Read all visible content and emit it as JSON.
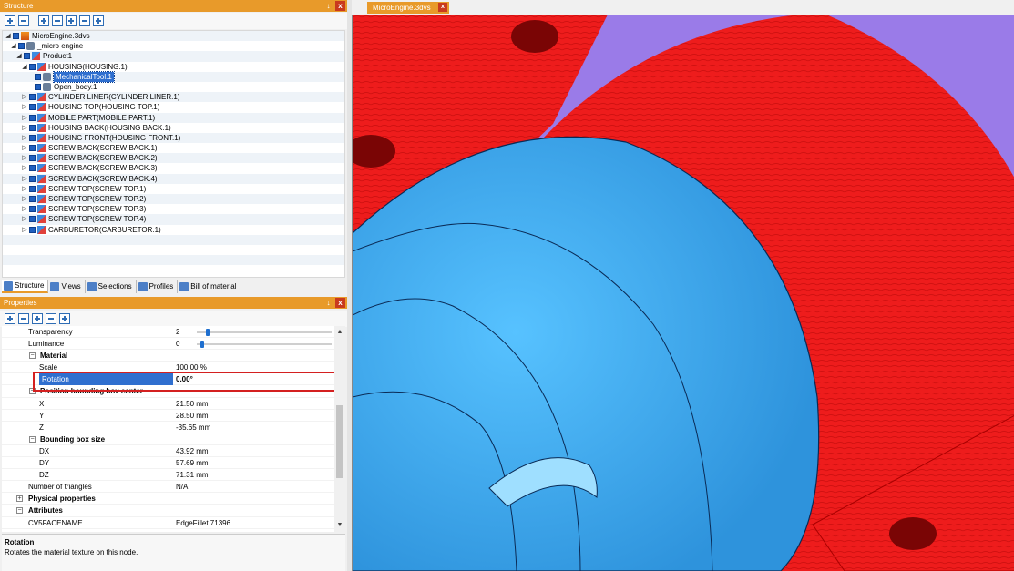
{
  "structure_panel": {
    "title": "Structure",
    "pin": "↓",
    "close": "x",
    "tree": [
      {
        "label": "MicroEngine.3dvs",
        "level": 0,
        "icon": "document-icon",
        "expand": "◢"
      },
      {
        "label": "_micro engine",
        "level": 1,
        "icon": "tool-icon",
        "expand": "◢"
      },
      {
        "label": "Product1",
        "level": 2,
        "icon": "part-icon",
        "expand": "◢"
      },
      {
        "label": "HOUSING(HOUSING.1)",
        "level": 3,
        "icon": "part-icon",
        "expand": "◢"
      },
      {
        "label": "MechanicalTool.1",
        "level": 4,
        "icon": "tool-icon",
        "expand": "",
        "selected": true
      },
      {
        "label": "Open_body.1",
        "level": 4,
        "icon": "tool-icon",
        "expand": ""
      },
      {
        "label": "CYLINDER LINER(CYLINDER LINER.1)",
        "level": 3,
        "icon": "part-icon",
        "expand": "▷"
      },
      {
        "label": "HOUSING TOP(HOUSING TOP.1)",
        "level": 3,
        "icon": "part-icon",
        "expand": "▷"
      },
      {
        "label": "MOBILE PART(MOBILE PART.1)",
        "level": 3,
        "icon": "part-icon",
        "expand": "▷"
      },
      {
        "label": "HOUSING BACK(HOUSING BACK.1)",
        "level": 3,
        "icon": "part-icon",
        "expand": "▷"
      },
      {
        "label": "HOUSING FRONT(HOUSING FRONT.1)",
        "level": 3,
        "icon": "part-icon",
        "expand": "▷"
      },
      {
        "label": "SCREW BACK(SCREW BACK.1)",
        "level": 3,
        "icon": "part-icon",
        "expand": "▷"
      },
      {
        "label": "SCREW BACK(SCREW BACK.2)",
        "level": 3,
        "icon": "part-icon",
        "expand": "▷"
      },
      {
        "label": "SCREW BACK(SCREW BACK.3)",
        "level": 3,
        "icon": "part-icon",
        "expand": "▷"
      },
      {
        "label": "SCREW BACK(SCREW BACK.4)",
        "level": 3,
        "icon": "part-icon",
        "expand": "▷"
      },
      {
        "label": "SCREW TOP(SCREW TOP.1)",
        "level": 3,
        "icon": "part-icon",
        "expand": "▷"
      },
      {
        "label": "SCREW TOP(SCREW TOP.2)",
        "level": 3,
        "icon": "part-icon",
        "expand": "▷"
      },
      {
        "label": "SCREW TOP(SCREW TOP.3)",
        "level": 3,
        "icon": "part-icon",
        "expand": "▷"
      },
      {
        "label": "SCREW TOP(SCREW TOP.4)",
        "level": 3,
        "icon": "part-icon",
        "expand": "▷"
      },
      {
        "label": "CARBURETOR(CARBURETOR.1)",
        "level": 3,
        "icon": "part-icon",
        "expand": "▷"
      }
    ],
    "tabs": [
      "Structure",
      "Views",
      "Selections",
      "Profiles",
      "Bill of material"
    ]
  },
  "properties_panel": {
    "title": "Properties",
    "pin": "↓",
    "close": "x",
    "rows": [
      {
        "name": "Transparency",
        "value": "2",
        "indent": 1,
        "slider": 0.04
      },
      {
        "name": "Luminance",
        "value": "0",
        "indent": 1,
        "slider": 0.0
      },
      {
        "name": "Material",
        "value": "",
        "indent": 1,
        "section": true,
        "toggle": "−"
      },
      {
        "name": "Scale",
        "value": "100.00 %",
        "indent": 2
      },
      {
        "name": "Rotation",
        "value": "0.00°",
        "indent": 2,
        "highlight": true
      },
      {
        "name": "Position bounding box center",
        "value": "",
        "indent": 1,
        "section": true,
        "toggle": "−"
      },
      {
        "name": "X",
        "value": "21.50 mm",
        "indent": 2
      },
      {
        "name": "Y",
        "value": "28.50 mm",
        "indent": 2
      },
      {
        "name": "Z",
        "value": "-35.65 mm",
        "indent": 2
      },
      {
        "name": "Bounding box size",
        "value": "",
        "indent": 1,
        "section": true,
        "toggle": "−"
      },
      {
        "name": "DX",
        "value": "43.92 mm",
        "indent": 2
      },
      {
        "name": "DY",
        "value": "57.69 mm",
        "indent": 2
      },
      {
        "name": "DZ",
        "value": "71.31 mm",
        "indent": 2
      },
      {
        "name": "Number of triangles",
        "value": "N/A",
        "indent": 1
      },
      {
        "name": "Physical properties",
        "value": "",
        "indent": 0,
        "section": true,
        "toggle": "+"
      },
      {
        "name": "Attributes",
        "value": "",
        "indent": 0,
        "section": true,
        "toggle": "−"
      },
      {
        "name": "CV5FACENAME",
        "value": "EdgeFillet.71396",
        "indent": 1
      }
    ],
    "description": {
      "title": "Rotation",
      "text": "Rotates the material texture on this node."
    }
  },
  "document": {
    "tab_label": "MicroEngine.3dvs",
    "close": "x"
  },
  "colors": {
    "accent": "#e89a2a",
    "selection": "#2f6fcf",
    "housing_red": "#ee1c1c",
    "part_blue": "#3aa6ec",
    "background_violet": "#9a7be8"
  }
}
